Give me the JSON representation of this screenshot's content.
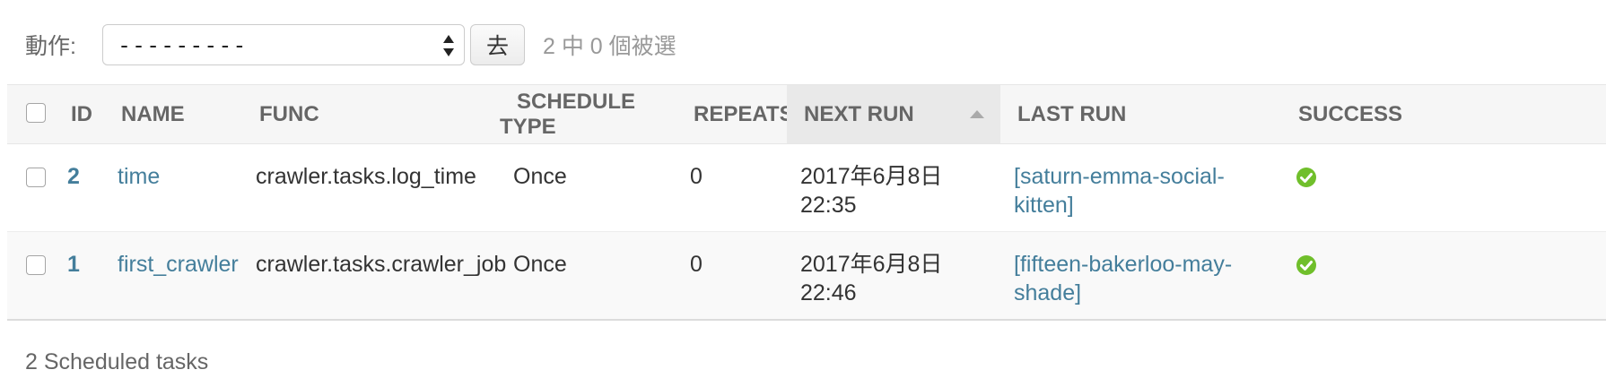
{
  "actions": {
    "label": "動作:",
    "select_value": "---------",
    "go_label": "去",
    "counter": "2 中 0 個被選"
  },
  "table": {
    "headers": {
      "id": "ID",
      "name": "NAME",
      "func": "FUNC",
      "schedule_type": "SCHEDULE TYPE",
      "repeats": "REPEATS",
      "next_run": "NEXT RUN",
      "last_run": "LAST RUN",
      "success": "SUCCESS"
    },
    "sorted_column": "next_run",
    "sort_direction": "ascending",
    "rows": [
      {
        "id": "2",
        "name": "time",
        "func": "crawler.tasks.log_time",
        "schedule_type": "Once",
        "repeats": "0",
        "next_run": "2017年6月8日 22:35",
        "last_run_line1": "[saturn-emma-social-",
        "last_run_line2": "kitten]",
        "success": true
      },
      {
        "id": "1",
        "name": "first_crawler",
        "func": "crawler.tasks.crawler_job",
        "schedule_type": "Once",
        "repeats": "0",
        "next_run": "2017年6月8日 22:46",
        "last_run_line1": "[fifteen-bakerloo-may-",
        "last_run_line2": "shade]",
        "success": true
      }
    ]
  },
  "paginator": "2 Scheduled tasks",
  "colors": {
    "link": "#447e9b",
    "success": "#70bf2b",
    "header_bg": "#f6f6f6",
    "sorted_header_bg": "#e9e9e9"
  },
  "icons": {
    "success": "check-circle-icon",
    "sort": "sort-ascending-icon",
    "select_arrows": "select-up-down-arrows-icon"
  }
}
